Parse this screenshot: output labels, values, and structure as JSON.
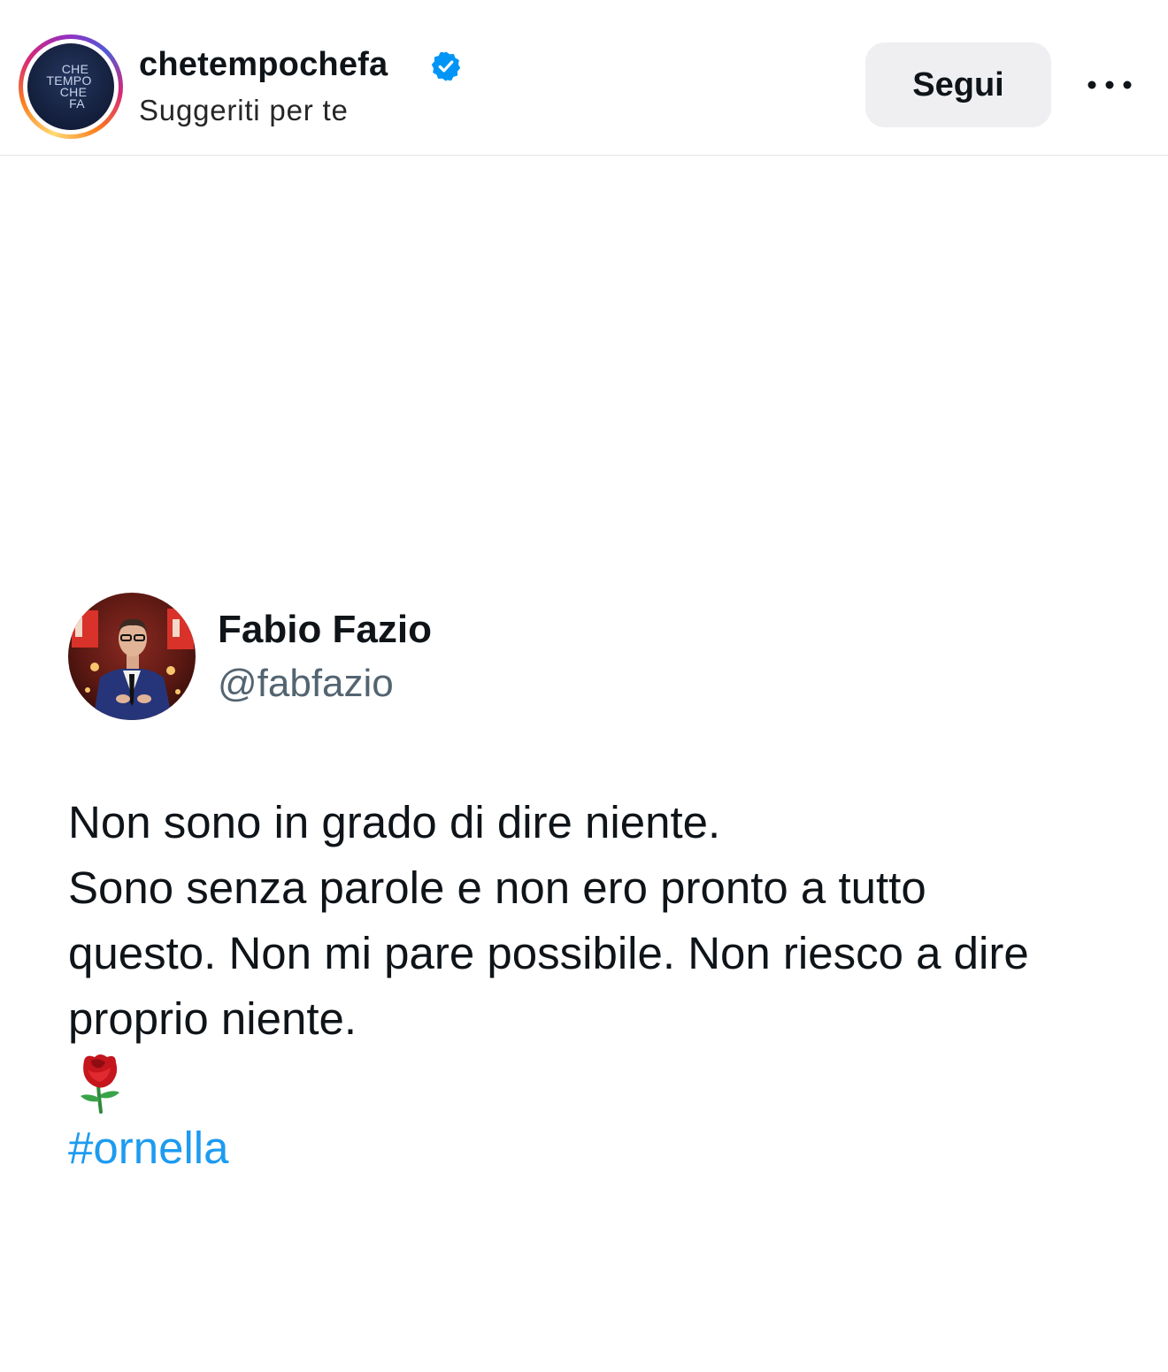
{
  "post": {
    "account": {
      "username": "chetempochefa",
      "verified": true,
      "subtitle": "Suggeriti per te",
      "avatar_logo_lines": [
        "CHE",
        "TEMPO",
        "CHE",
        "FA"
      ],
      "follow_label": "Segui",
      "more_icon": "more-horizontal-icon"
    },
    "tweet": {
      "author_name": "Fabio Fazio",
      "author_handle": "@fabfazio",
      "lines": [
        "Non sono in grado di dire niente.",
        "Sono senza parole e non ero pronto a tutto",
        "questo. Non mi pare possibile. Non riesco a dire",
        "proprio niente."
      ],
      "emoji_icon": "rose-icon",
      "hashtag": "#ornella"
    }
  },
  "colors": {
    "verified_blue": "#0095f6",
    "hashtag_blue": "#1d9bf0",
    "follow_button_bg": "#efeff2",
    "handle_gray": "#536471"
  }
}
